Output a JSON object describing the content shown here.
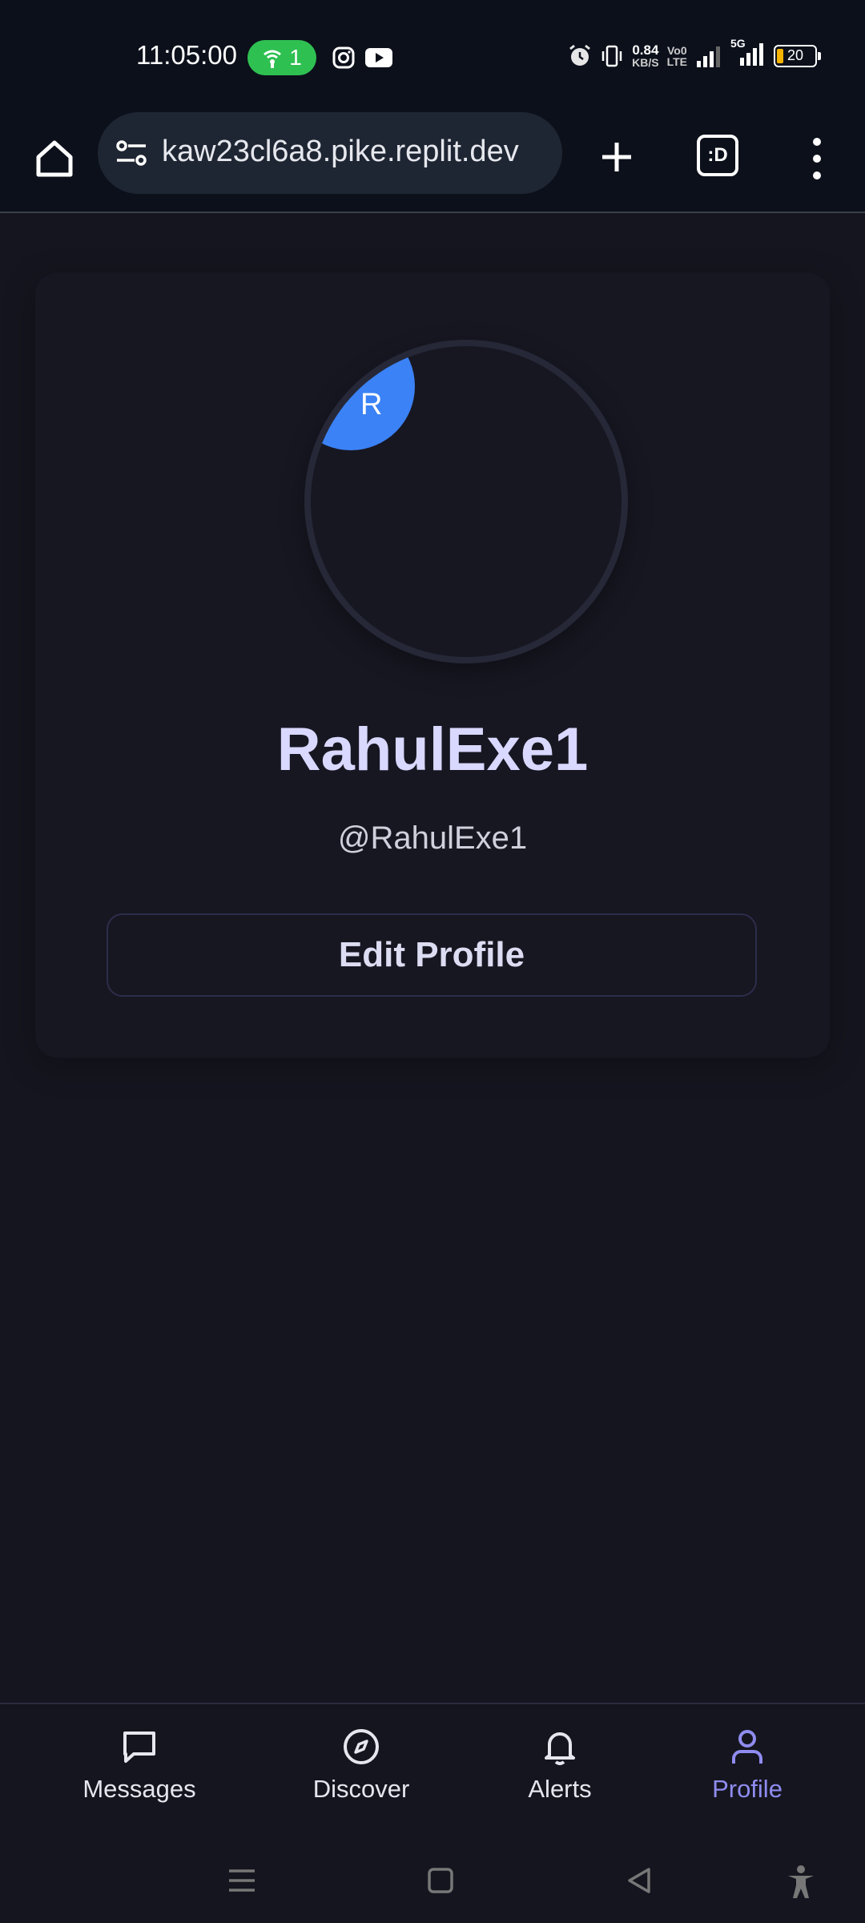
{
  "status_bar": {
    "time": "11:05:00",
    "hotspot_count": "1",
    "data_rate": "0.84",
    "data_unit": "KB/S",
    "network_label_1": "Vo0",
    "network_label_2": "LTE",
    "network_5g": "5G",
    "battery": "20",
    "battery_color": "#f5b400"
  },
  "browser": {
    "url": "kaw23cl6a8.pike.replit.dev",
    "tab_icon_text": ":D"
  },
  "profile": {
    "avatar_letter": "R",
    "avatar_color": "#3b82f6",
    "display_name": "RahulExe1",
    "username": "@RahulExe1",
    "edit_button_label": "Edit Profile",
    "accent_color": "#d9d8ff"
  },
  "bottom_nav": {
    "items": [
      {
        "label": "Messages",
        "icon": "chat-bubble-icon"
      },
      {
        "label": "Discover",
        "icon": "compass-icon"
      },
      {
        "label": "Alerts",
        "icon": "bell-icon"
      },
      {
        "label": "Profile",
        "icon": "user-icon"
      }
    ],
    "active": "Profile",
    "active_color": "#8f8cf0"
  },
  "system_nav": {
    "icons": [
      "menu-icon",
      "home-square-icon",
      "back-icon",
      "accessibility-icon"
    ]
  }
}
